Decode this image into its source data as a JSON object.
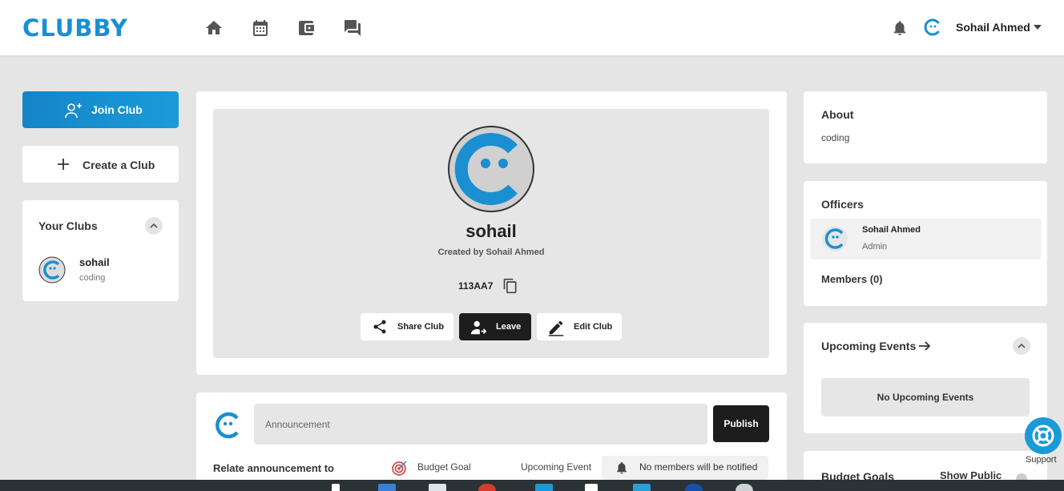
{
  "header": {
    "logo": "CLUBBY",
    "nav_icons": [
      "home-icon",
      "calendar-icon",
      "wallet-icon",
      "chat-icon"
    ],
    "user_name": "Sohail Ahmed"
  },
  "sidebar": {
    "join_label": "Join Club",
    "create_label": "Create a Club",
    "your_clubs_title": "Your Clubs",
    "clubs": [
      {
        "name": "sohail",
        "description": "coding"
      }
    ]
  },
  "club": {
    "name": "sohail",
    "created_by": "Created by Sohail Ahmed",
    "code": "113AA7",
    "actions": {
      "share": "Share Club",
      "leave": "Leave",
      "edit": "Edit Club"
    }
  },
  "announcement": {
    "placeholder": "Announcement",
    "publish_label": "Publish",
    "relate_label": "Relate announcement to",
    "budget_goal": "Budget Goal",
    "upcoming_event": "Upcoming Event",
    "notify_text": "No members will be notified"
  },
  "about": {
    "title": "About",
    "text": "coding"
  },
  "officers": {
    "title": "Officers",
    "list": [
      {
        "name": "Sohail Ahmed",
        "role": "Admin"
      }
    ],
    "members_label": "Members (0)"
  },
  "events": {
    "title": "Upcoming Events",
    "empty_text": "No Upcoming Events"
  },
  "budget": {
    "title": "Budget Goals",
    "show_public": "Show Public"
  },
  "support_label": "Support",
  "colors": {
    "brand": "#1a8fd1",
    "dark_button": "#1d1d1d",
    "background": "#e5e5e5"
  }
}
